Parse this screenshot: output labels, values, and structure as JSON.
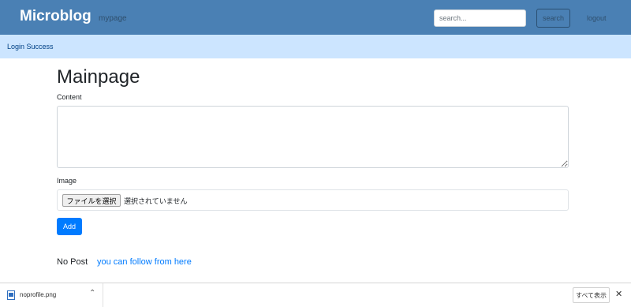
{
  "navbar": {
    "brand": "Microblog",
    "mypage_link": "mypage",
    "search_placeholder": "search...",
    "search_button": "search",
    "logout_link": "logout",
    "background": "#4a80b4"
  },
  "alert": {
    "message": "Login Success"
  },
  "main": {
    "title": "Mainpage",
    "content_label": "Content",
    "content_value": "",
    "image_label": "Image",
    "file_button": "ファイルを選択",
    "file_status": "選択されていません",
    "add_button": "Add",
    "no_post": "No Post",
    "follow_link": "you can follow from here"
  },
  "download_bar": {
    "filename": "noprofile.png",
    "show_all": "すべて表示",
    "icons": [
      "image-file-icon",
      "chevron-up-icon",
      "close-icon"
    ]
  }
}
